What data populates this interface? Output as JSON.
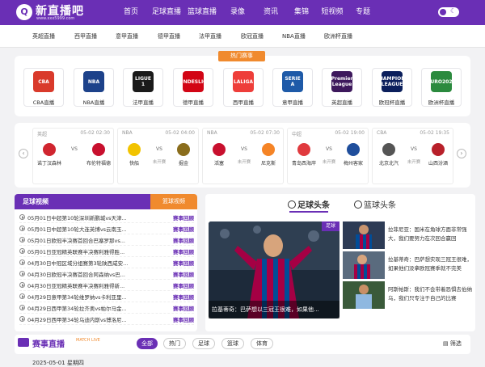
{
  "brand": {
    "mark": "Q",
    "title": "新直播吧",
    "url": "www.xxx5999.com"
  },
  "nav": [
    "首页",
    "足球直播",
    "篮球直播",
    "录像",
    "资讯",
    "集锦",
    "短视频",
    "专题"
  ],
  "subnav": [
    "英超直播",
    "西甲直播",
    "意甲直播",
    "德甲直播",
    "法甲直播",
    "欧冠直播",
    "NBA直播",
    "欧洲杯直播"
  ],
  "hot_label": "热门赛事",
  "leagues": [
    {
      "label": "CBA直播",
      "logo": "CBA",
      "color": "#d93a2b"
    },
    {
      "label": "NBA直播",
      "logo": "NBA",
      "color": "#1d428a"
    },
    {
      "label": "法甲直播",
      "logo": "LIGUE 1",
      "color": "#1a1a1a"
    },
    {
      "label": "德甲直播",
      "logo": "BUNDESLIGA",
      "color": "#d20515"
    },
    {
      "label": "西甲直播",
      "logo": "LALIGA",
      "color": "#ee3e3a"
    },
    {
      "label": "意甲直播",
      "logo": "SERIE A",
      "color": "#1e5aa8"
    },
    {
      "label": "英超直播",
      "logo": "Premier League",
      "color": "#3d185c"
    },
    {
      "label": "欧冠杯直播",
      "logo": "CHAMPIONS LEAGUE",
      "color": "#0b1f5c"
    },
    {
      "label": "欧洲杯直播",
      "logo": "EURO2024",
      "color": "#2b8a3e"
    }
  ],
  "matches": [
    {
      "league": "英超",
      "time": "05-02 02:30",
      "home": "诺丁汉森林",
      "away": "布伦特福德",
      "status": "",
      "home_color": "#d0252f",
      "away_color": "#c8102e"
    },
    {
      "league": "NBA",
      "time": "05-02 04:00",
      "home": "快船",
      "away": "掘金",
      "status": "未开赛",
      "home_color": "#f2c300",
      "away_color": "#8a6d1c"
    },
    {
      "league": "NBA",
      "time": "05-02 07:30",
      "home": "活塞",
      "away": "尼克斯",
      "status": "未开赛",
      "home_color": "#c8102e",
      "away_color": "#f58426"
    },
    {
      "league": "中超",
      "time": "05-02 19:00",
      "home": "青岛西海岸",
      "away": "梅州客家",
      "status": "未开赛",
      "home_color": "#e03a3e",
      "away_color": "#1f4e9c"
    },
    {
      "league": "CBA",
      "time": "05-02 19:35",
      "home": "北京北汽",
      "away": "山西汾酒",
      "status": "未开赛",
      "home_color": "#555555",
      "away_color": "#b8202a"
    }
  ],
  "vs_label": "VS",
  "videos": {
    "title": "足球视频",
    "tab": "篮球视频",
    "items": [
      {
        "text": "05月01日中超第10轮深圳新鹏城vs天津...",
        "tag": "赛事回顾"
      },
      {
        "text": "05月01日中超第10轮大连英博vs云南玉...",
        "tag": "赛事回顾"
      },
      {
        "text": "05月01日欧冠半决赛首回合巴塞罗那vs...",
        "tag": "赛事回顾"
      },
      {
        "text": "05月01日亚冠精英联赛半决赛利雅得胜...",
        "tag": "赛事回顾"
      },
      {
        "text": "04月30日中冠区域分组赛第3轮陕西咸安...",
        "tag": "赛事回顾"
      },
      {
        "text": "04月30日欧冠半决赛首回合阿森纳vs巴...",
        "tag": "赛事回顾"
      },
      {
        "text": "04月30日亚冠精英联赛半决赛利雅得新...",
        "tag": "赛事回顾"
      },
      {
        "text": "04月29日意甲第34轮维罗纳vs卡利亚里...",
        "tag": "赛事回顾"
      },
      {
        "text": "04月29日西甲第34轮拉齐奥vs帕尔马金...",
        "tag": "赛事回顾"
      },
      {
        "text": "04月29日西甲第34轮乌迪内斯vs博洛尼...",
        "tag": "赛事回顾"
      }
    ]
  },
  "news": {
    "tabs": [
      "足球头条",
      "篮球头条"
    ],
    "hero_tag": "足球",
    "hero_caption": "拉基蒂奇：巴萨想以三冠王很难，如果他...",
    "items": [
      "拉菲尼亚：国米在角球方面非常强大，我们要努力在次回合赢回",
      "拉基蒂奇：巴萨想实现三冠王很难，如果他们没拿欧冠赛季就不完美",
      "阿斯帕斯：我们不会带着恐惧去伯纳乌，我们只专注于自己的比赛"
    ]
  },
  "live": {
    "title": "赛事直播",
    "badge": "MATCH LIVE",
    "filters": [
      "全部",
      "热门",
      "足球",
      "篮球",
      "体育"
    ],
    "sift": "筛选",
    "date": "2025-05-01 星期四"
  }
}
